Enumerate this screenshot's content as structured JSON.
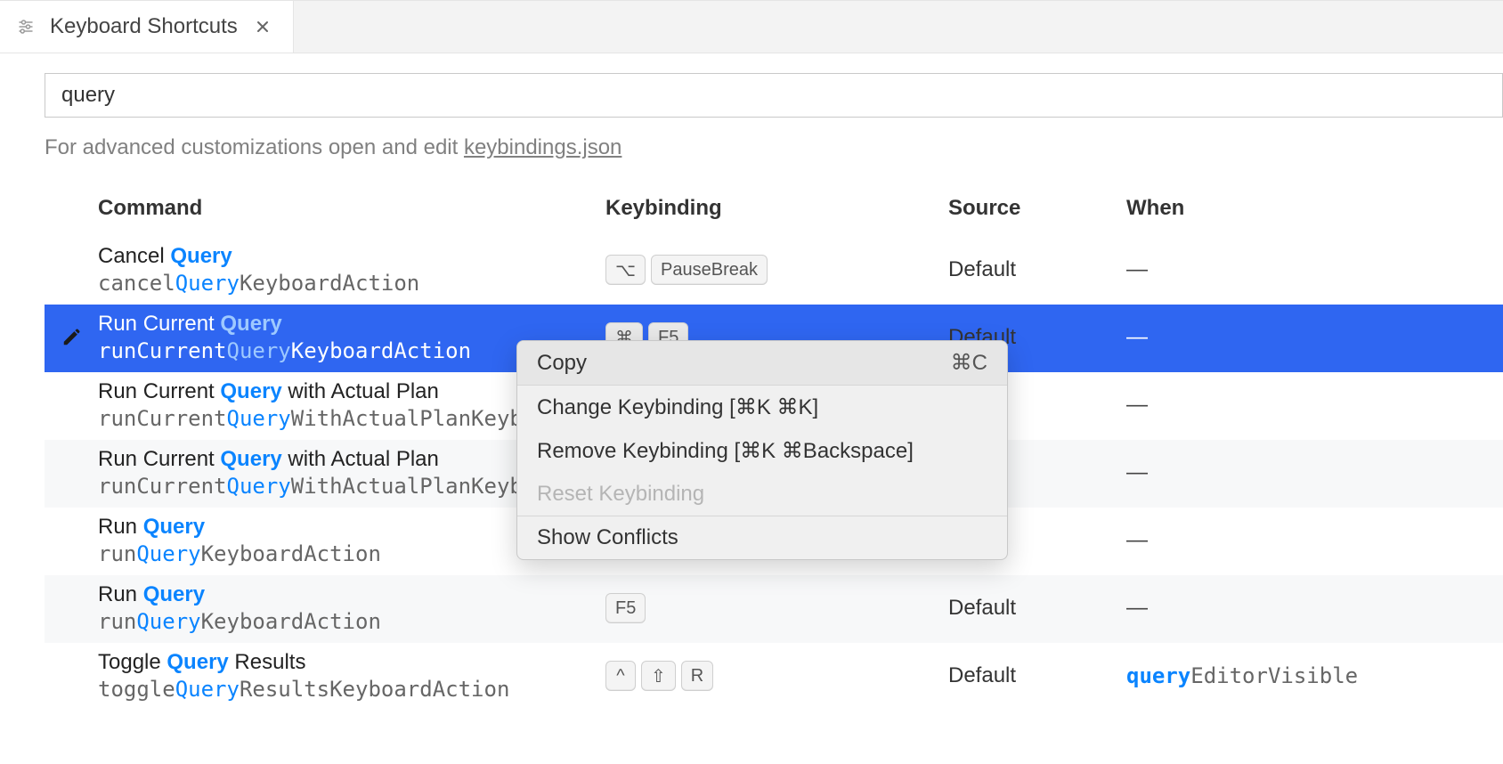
{
  "tab": {
    "title": "Keyboard Shortcuts"
  },
  "search": {
    "value": "query"
  },
  "hint": {
    "prefix": "For advanced customizations open and edit ",
    "link": "keybindings.json"
  },
  "headers": {
    "command": "Command",
    "keybinding": "Keybinding",
    "source": "Source",
    "when": "When"
  },
  "contextMenu": {
    "copy": {
      "label": "Copy",
      "shortcut": "⌘C"
    },
    "change": {
      "label": "Change Keybinding [⌘K ⌘K]"
    },
    "remove": {
      "label": "Remove Keybinding [⌘K ⌘Backspace]"
    },
    "reset": {
      "label": "Reset Keybinding"
    },
    "showConflicts": {
      "label": "Show Conflicts"
    }
  },
  "rows": [
    {
      "title_pre": "Cancel ",
      "title_hl": "Query",
      "title_post": "",
      "id_pre": "cancel",
      "id_hl": "Query",
      "id_post": "KeyboardAction",
      "keys": [
        "⌥",
        "PauseBreak"
      ],
      "source": "Default",
      "when": "—"
    },
    {
      "title_pre": "Run Current ",
      "title_hl": "Query",
      "title_post": "",
      "id_pre": "runCurrent",
      "id_hl": "Query",
      "id_post": "KeyboardAction",
      "keys": [
        "⌘",
        "F5"
      ],
      "source": "Default",
      "when": "—"
    },
    {
      "title_pre": "Run Current ",
      "title_hl": "Query",
      "title_post": " with Actual Plan",
      "id_pre": "runCurrent",
      "id_hl": "Query",
      "id_post": "WithActualPlanKeyboar",
      "keys": [],
      "source": "",
      "when": "—"
    },
    {
      "title_pre": "Run Current ",
      "title_hl": "Query",
      "title_post": " with Actual Plan",
      "id_pre": "runCurrent",
      "id_hl": "Query",
      "id_post": "WithActualPlanKeyboar",
      "keys": [],
      "source": "lt",
      "when": "—"
    },
    {
      "title_pre": "Run ",
      "title_hl": "Query",
      "title_post": "",
      "id_pre": "run",
      "id_hl": "Query",
      "id_post": "KeyboardAction",
      "keys": [],
      "source": "lt",
      "when": "—"
    },
    {
      "title_pre": "Run ",
      "title_hl": "Query",
      "title_post": "",
      "id_pre": "run",
      "id_hl": "Query",
      "id_post": "KeyboardAction",
      "keys": [
        "F5"
      ],
      "source": "Default",
      "when": "—"
    },
    {
      "title_pre": "Toggle ",
      "title_hl": "Query",
      "title_post": " Results",
      "id_pre": "toggle",
      "id_hl": "Query",
      "id_post": "ResultsKeyboardAction",
      "keys": [
        "^",
        "⇧",
        "R"
      ],
      "source": "Default",
      "when_hl": "query",
      "when_post": "EditorVisible"
    }
  ]
}
